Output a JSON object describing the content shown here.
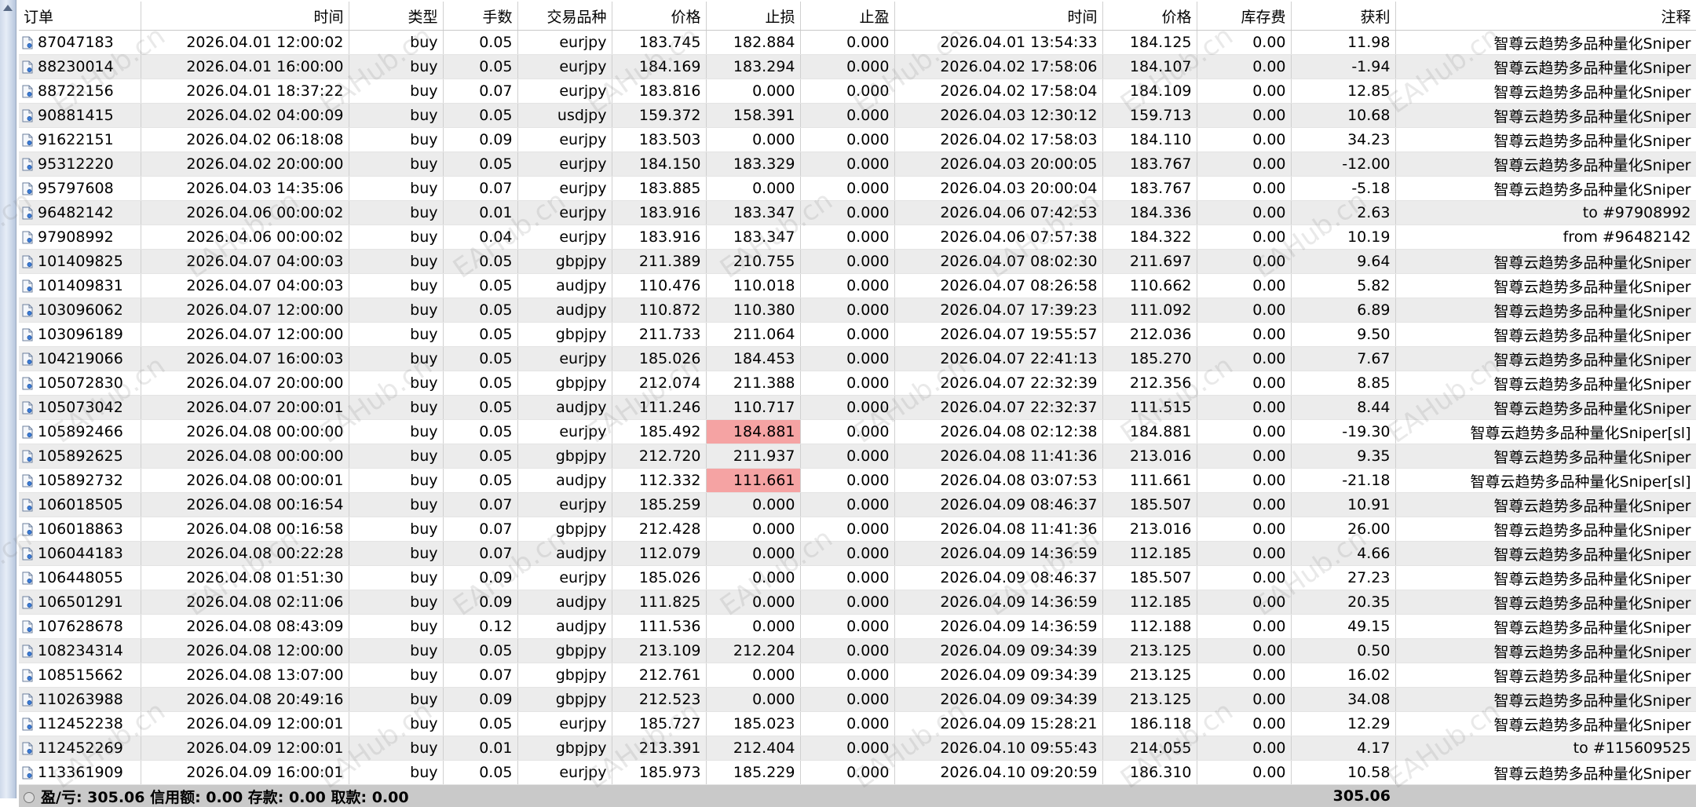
{
  "columns": [
    "订单",
    "时间",
    "类型",
    "手数",
    "交易品种",
    "价格",
    "止损",
    "止盈",
    "时间",
    "价格",
    "库存费",
    "获利",
    "注释"
  ],
  "rows": [
    [
      "87047183",
      "2026.04.01 12:00:02",
      "buy",
      "0.05",
      "eurjpy",
      "183.745",
      "182.884",
      "0.000",
      "2026.04.01 13:54:33",
      "184.125",
      "0.00",
      "11.98",
      "智尊云趋势多品种量化Sniper"
    ],
    [
      "88230014",
      "2026.04.01 16:00:00",
      "buy",
      "0.05",
      "eurjpy",
      "184.169",
      "183.294",
      "0.000",
      "2026.04.02 17:58:06",
      "184.107",
      "0.00",
      "-1.94",
      "智尊云趋势多品种量化Sniper"
    ],
    [
      "88722156",
      "2026.04.01 18:37:22",
      "buy",
      "0.07",
      "eurjpy",
      "183.816",
      "0.000",
      "0.000",
      "2026.04.02 17:58:04",
      "184.109",
      "0.00",
      "12.85",
      "智尊云趋势多品种量化Sniper"
    ],
    [
      "90881415",
      "2026.04.02 04:00:09",
      "buy",
      "0.05",
      "usdjpy",
      "159.372",
      "158.391",
      "0.000",
      "2026.04.03 12:30:12",
      "159.713",
      "0.00",
      "10.68",
      "智尊云趋势多品种量化Sniper"
    ],
    [
      "91622151",
      "2026.04.02 06:18:08",
      "buy",
      "0.09",
      "eurjpy",
      "183.503",
      "0.000",
      "0.000",
      "2026.04.02 17:58:03",
      "184.110",
      "0.00",
      "34.23",
      "智尊云趋势多品种量化Sniper"
    ],
    [
      "95312220",
      "2026.04.02 20:00:00",
      "buy",
      "0.05",
      "eurjpy",
      "184.150",
      "183.329",
      "0.000",
      "2026.04.03 20:00:05",
      "183.767",
      "0.00",
      "-12.00",
      "智尊云趋势多品种量化Sniper"
    ],
    [
      "95797608",
      "2026.04.03 14:35:06",
      "buy",
      "0.07",
      "eurjpy",
      "183.885",
      "0.000",
      "0.000",
      "2026.04.03 20:00:04",
      "183.767",
      "0.00",
      "-5.18",
      "智尊云趋势多品种量化Sniper"
    ],
    [
      "96482142",
      "2026.04.06 00:00:02",
      "buy",
      "0.01",
      "eurjpy",
      "183.916",
      "183.347",
      "0.000",
      "2026.04.06 07:42:53",
      "184.336",
      "0.00",
      "2.63",
      "to #97908992"
    ],
    [
      "97908992",
      "2026.04.06 00:00:02",
      "buy",
      "0.04",
      "eurjpy",
      "183.916",
      "183.347",
      "0.000",
      "2026.04.06 07:57:38",
      "184.322",
      "0.00",
      "10.19",
      "from #96482142"
    ],
    [
      "101409825",
      "2026.04.07 04:00:03",
      "buy",
      "0.05",
      "gbpjpy",
      "211.389",
      "210.755",
      "0.000",
      "2026.04.07 08:02:30",
      "211.697",
      "0.00",
      "9.64",
      "智尊云趋势多品种量化Sniper"
    ],
    [
      "101409831",
      "2026.04.07 04:00:03",
      "buy",
      "0.05",
      "audjpy",
      "110.476",
      "110.018",
      "0.000",
      "2026.04.07 08:26:58",
      "110.662",
      "0.00",
      "5.82",
      "智尊云趋势多品种量化Sniper"
    ],
    [
      "103096062",
      "2026.04.07 12:00:00",
      "buy",
      "0.05",
      "audjpy",
      "110.872",
      "110.380",
      "0.000",
      "2026.04.07 17:39:23",
      "111.092",
      "0.00",
      "6.89",
      "智尊云趋势多品种量化Sniper"
    ],
    [
      "103096189",
      "2026.04.07 12:00:00",
      "buy",
      "0.05",
      "gbpjpy",
      "211.733",
      "211.064",
      "0.000",
      "2026.04.07 19:55:57",
      "212.036",
      "0.00",
      "9.50",
      "智尊云趋势多品种量化Sniper"
    ],
    [
      "104219066",
      "2026.04.07 16:00:03",
      "buy",
      "0.05",
      "eurjpy",
      "185.026",
      "184.453",
      "0.000",
      "2026.04.07 22:41:13",
      "185.270",
      "0.00",
      "7.67",
      "智尊云趋势多品种量化Sniper"
    ],
    [
      "105072830",
      "2026.04.07 20:00:00",
      "buy",
      "0.05",
      "gbpjpy",
      "212.074",
      "211.388",
      "0.000",
      "2026.04.07 22:32:39",
      "212.356",
      "0.00",
      "8.85",
      "智尊云趋势多品种量化Sniper"
    ],
    [
      "105073042",
      "2026.04.07 20:00:01",
      "buy",
      "0.05",
      "audjpy",
      "111.246",
      "110.717",
      "0.000",
      "2026.04.07 22:32:37",
      "111.515",
      "0.00",
      "8.44",
      "智尊云趋势多品种量化Sniper"
    ],
    [
      "105892466",
      "2026.04.08 00:00:00",
      "buy",
      "0.05",
      "eurjpy",
      "185.492",
      "184.881",
      "0.000",
      "2026.04.08 02:12:38",
      "184.881",
      "0.00",
      "-19.30",
      "智尊云趋势多品种量化Sniper[sl]"
    ],
    [
      "105892625",
      "2026.04.08 00:00:00",
      "buy",
      "0.05",
      "gbpjpy",
      "212.720",
      "211.937",
      "0.000",
      "2026.04.08 11:41:36",
      "213.016",
      "0.00",
      "9.35",
      "智尊云趋势多品种量化Sniper"
    ],
    [
      "105892732",
      "2026.04.08 00:00:01",
      "buy",
      "0.05",
      "audjpy",
      "112.332",
      "111.661",
      "0.000",
      "2026.04.08 03:07:53",
      "111.661",
      "0.00",
      "-21.18",
      "智尊云趋势多品种量化Sniper[sl]"
    ],
    [
      "106018505",
      "2026.04.08 00:16:54",
      "buy",
      "0.07",
      "eurjpy",
      "185.259",
      "0.000",
      "0.000",
      "2026.04.09 08:46:37",
      "185.507",
      "0.00",
      "10.91",
      "智尊云趋势多品种量化Sniper"
    ],
    [
      "106018863",
      "2026.04.08 00:16:58",
      "buy",
      "0.07",
      "gbpjpy",
      "212.428",
      "0.000",
      "0.000",
      "2026.04.08 11:41:36",
      "213.016",
      "0.00",
      "26.00",
      "智尊云趋势多品种量化Sniper"
    ],
    [
      "106044183",
      "2026.04.08 00:22:28",
      "buy",
      "0.07",
      "audjpy",
      "112.079",
      "0.000",
      "0.000",
      "2026.04.09 14:36:59",
      "112.185",
      "0.00",
      "4.66",
      "智尊云趋势多品种量化Sniper"
    ],
    [
      "106448055",
      "2026.04.08 01:51:30",
      "buy",
      "0.09",
      "eurjpy",
      "185.026",
      "0.000",
      "0.000",
      "2026.04.09 08:46:37",
      "185.507",
      "0.00",
      "27.23",
      "智尊云趋势多品种量化Sniper"
    ],
    [
      "106501291",
      "2026.04.08 02:11:06",
      "buy",
      "0.09",
      "audjpy",
      "111.825",
      "0.000",
      "0.000",
      "2026.04.09 14:36:59",
      "112.185",
      "0.00",
      "20.35",
      "智尊云趋势多品种量化Sniper"
    ],
    [
      "107628678",
      "2026.04.08 08:43:09",
      "buy",
      "0.12",
      "audjpy",
      "111.536",
      "0.000",
      "0.000",
      "2026.04.09 14:36:59",
      "112.188",
      "0.00",
      "49.15",
      "智尊云趋势多品种量化Sniper"
    ],
    [
      "108234314",
      "2026.04.08 12:00:00",
      "buy",
      "0.05",
      "gbpjpy",
      "213.109",
      "212.204",
      "0.000",
      "2026.04.09 09:34:39",
      "213.125",
      "0.00",
      "0.50",
      "智尊云趋势多品种量化Sniper"
    ],
    [
      "108515662",
      "2026.04.08 13:07:00",
      "buy",
      "0.07",
      "gbpjpy",
      "212.761",
      "0.000",
      "0.000",
      "2026.04.09 09:34:39",
      "213.125",
      "0.00",
      "16.02",
      "智尊云趋势多品种量化Sniper"
    ],
    [
      "110263988",
      "2026.04.08 20:49:16",
      "buy",
      "0.09",
      "gbpjpy",
      "212.523",
      "0.000",
      "0.000",
      "2026.04.09 09:34:39",
      "213.125",
      "0.00",
      "34.08",
      "智尊云趋势多品种量化Sniper"
    ],
    [
      "112452238",
      "2026.04.09 12:00:01",
      "buy",
      "0.05",
      "eurjpy",
      "185.727",
      "185.023",
      "0.000",
      "2026.04.09 15:28:21",
      "186.118",
      "0.00",
      "12.29",
      "智尊云趋势多品种量化Sniper"
    ],
    [
      "112452269",
      "2026.04.09 12:00:01",
      "buy",
      "0.01",
      "gbpjpy",
      "213.391",
      "212.404",
      "0.000",
      "2026.04.10 09:55:43",
      "214.055",
      "0.00",
      "4.17",
      "to #115609525"
    ],
    [
      "113361909",
      "2026.04.09 16:00:01",
      "buy",
      "0.05",
      "eurjpy",
      "185.973",
      "185.229",
      "0.000",
      "2026.04.10 09:20:59",
      "186.310",
      "0.00",
      "10.58",
      "智尊云趋势多品种量化Sniper"
    ]
  ],
  "sl_hit_rows": [
    16,
    18
  ],
  "summary": {
    "text": "盈/亏: 305.06  信用额: 0.00  存款: 0.00  取款: 0.00",
    "total": "305.06"
  },
  "watermark": "EAHub.cn",
  "colors": {
    "row_alt": "#ececec",
    "sl_highlight": "#f5a3a3",
    "footer": "#c9c9c9"
  },
  "icons": {
    "row": "document-icon",
    "summary": "summary-icon"
  }
}
